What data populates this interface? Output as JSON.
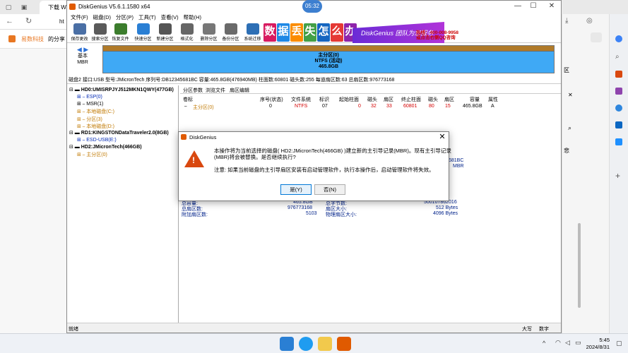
{
  "browser": {
    "tab_label": "下载 W",
    "addr_prefix": "ht",
    "fav_brand": "易数科技",
    "fav_text": "的分享",
    "time_bubble": "05:32",
    "side_text_1": "区",
    "side_text_2": "悲",
    "close_glyph": "✕"
  },
  "window": {
    "title": "DiskGenius V5.6.1.1580 x64",
    "min": "—",
    "max": "☐",
    "close": "✕"
  },
  "menu": [
    "文件(F)",
    "磁盘(D)",
    "分区(P)",
    "工具(T)",
    "查看(V)",
    "帮助(H)"
  ],
  "toolbar": [
    {
      "label": "保存更改",
      "color": "#4a6fa5"
    },
    {
      "label": "搜索分区",
      "color": "#5a5a5a"
    },
    {
      "label": "恢复文件",
      "color": "#3c7d2d"
    },
    {
      "label": "快速分区",
      "color": "#2a7fd4"
    },
    {
      "label": "新建分区",
      "color": "#555555"
    },
    {
      "label": "格式化",
      "color": "#666666"
    },
    {
      "label": "删除分区",
      "color": "#777777"
    },
    {
      "label": "备份分区",
      "color": "#6a6a6a"
    },
    {
      "label": "系统迁移",
      "color": "#2d6fb5"
    }
  ],
  "banner": {
    "chars": [
      {
        "ch": "数",
        "color": "#d81b60"
      },
      {
        "ch": "据",
        "color": "#1e88e5"
      },
      {
        "ch": "丢",
        "color": "#fb8c00"
      },
      {
        "ch": "失",
        "color": "#43a047"
      },
      {
        "ch": "怎",
        "color": "#1565c0"
      },
      {
        "ch": "么",
        "color": "#e53935"
      },
      {
        "ch": "办",
        "color": "#8e24aa"
      }
    ],
    "promo": "DiskGenius 团队为您服务",
    "phone": "热线：400-008-9958",
    "qq": "或点击右侧QQ咨询"
  },
  "disk_nav": {
    "basic": "基本",
    "type": "MBR"
  },
  "partition_bar": {
    "name": "主分区(0)",
    "fs": "NTFS (活动)",
    "size": "465.8GB"
  },
  "disk_info": "磁盘2 接口:USB  型号:JMicronTech  序列号:DB12345681BC  容量:465.8GB(476940MB)  柱面数:60801  磁头数:255  每道扇区数:63  总扇区数:976773168",
  "tree": [
    {
      "text": "HD0:UMISRPJYJ512MKN1QWY(477GB)",
      "cls": "b"
    },
    {
      "text": "ESP(0)",
      "cls": "blue"
    },
    {
      "text": "MSR(1)",
      "cls": ""
    },
    {
      "text": "本地磁盘(C:)",
      "cls": "pn"
    },
    {
      "text": "分区(3)",
      "cls": "pn"
    },
    {
      "text": "本地磁盘(D:)",
      "cls": "pn"
    },
    {
      "text": "RD1:KINGSTONDataTraveler2.0(8GB)",
      "cls": "b"
    },
    {
      "text": "ESD-USB(E:)",
      "cls": "blue"
    },
    {
      "text": "HD2:JMicronTech(466GB)",
      "cls": "b"
    },
    {
      "text": "主分区(0)",
      "cls": "pn"
    }
  ],
  "tabs": [
    "分区参数",
    "浏览文件",
    "扇区编辑"
  ],
  "table": {
    "headers": [
      "卷标",
      "序号(状态)",
      "文件系统",
      "标识",
      "起始柱面",
      "磁头",
      "扇区",
      "终止柱面",
      "磁头",
      "扇区",
      "容量",
      "属性"
    ],
    "row": [
      "主分区(0)",
      "0",
      "NTFS",
      "07",
      "0",
      "32",
      "33",
      "60801",
      "80",
      "15",
      "465.8GB",
      "A"
    ]
  },
  "stats": {
    "total_label": "总容量:",
    "total_value": "465.8GB",
    "sectors_label": "总扇区数:",
    "sectors_value": "976773168",
    "extra_label": "附加扇区数:",
    "extra_value": "5103",
    "bytes_label": "总字节数:",
    "bytes_value": "500107862016",
    "sector_size_label": "扇区大小:",
    "sector_size_value": "512 Bytes",
    "phys_label": "物理扇区大小:",
    "phys_value": "4096 Bytes",
    "partial_1": "681BC",
    "partial_2": "MBR"
  },
  "status": {
    "left": "就绪",
    "caps": "大写",
    "num": "数字"
  },
  "dialog": {
    "title": "DiskGenius",
    "line1": "本操作将为当前选择的磁盘( HD2:JMicronTech(466GB) )建立新的主引导记录(MBR)。现有主引导记录",
    "line2": "(MBR)将会被替换。是否继续执行?",
    "line3": "注意: 如果当前磁盘的主引导扇区安装有启动管理软件，执行本操作后，启动管理软件将失效。",
    "yes": "是(Y)",
    "no": "否(N)"
  },
  "taskbar": {
    "time": "5:45",
    "date": "2024/8/31"
  }
}
